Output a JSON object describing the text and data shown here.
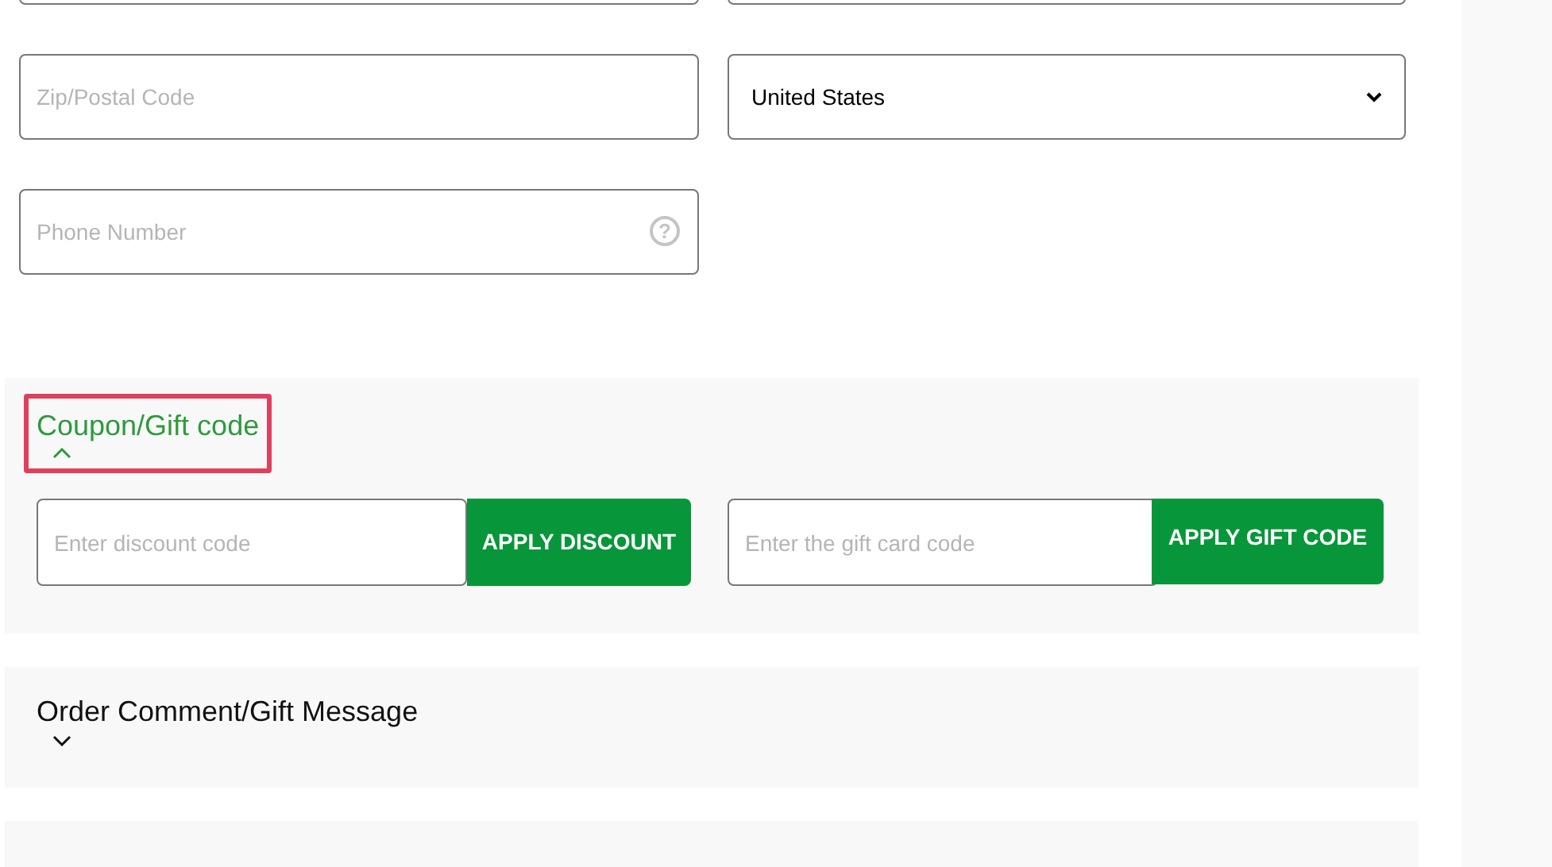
{
  "fields": [
    {
      "kind": "text",
      "placeholder": "Zip/Postal Code"
    },
    {
      "kind": "select",
      "value": "United States"
    },
    {
      "kind": "text",
      "placeholder": "Phone Number",
      "help": "?"
    }
  ],
  "sections": [
    {
      "title": "Coupon/Gift code",
      "expanded": true,
      "highlighted": true,
      "codes": [
        {
          "placeholder": "Enter discount code",
          "button": "APPLY DISCOUNT"
        },
        {
          "placeholder": "Enter the gift card code",
          "button": "APPLY GIFT CODE"
        }
      ]
    },
    {
      "title": "Order Comment/Gift Message",
      "expanded": false,
      "highlighted": false
    }
  ]
}
